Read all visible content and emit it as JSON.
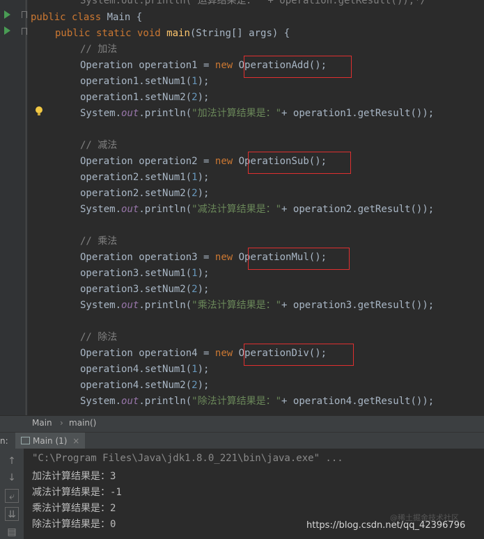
{
  "editor": {
    "top_partial": "System.out.println(\"运算结果是：\" + operation.getResult());*/",
    "class_decl": {
      "kw": "public class ",
      "name": "Main {"
    },
    "main_decl": {
      "kw1": "public static void ",
      "fn": "main",
      "rest": "(String[] args) {"
    },
    "blocks": [
      {
        "comment": "// 加法",
        "cls": "OperationAdd",
        "var": "operation1",
        "msg": "\"加法计算结果是：\""
      },
      {
        "comment": "// 减法",
        "cls": "OperationSub",
        "var": "operation2",
        "msg": "\"减法计算结果是：\""
      },
      {
        "comment": "// 乘法",
        "cls": "OperationMul",
        "var": "operation3",
        "msg": "\"乘法计算结果是：\""
      },
      {
        "comment": "// 除法",
        "cls": "OperationDiv",
        "var": "operation4",
        "msg": "\"除法计算结果是：\""
      }
    ],
    "tokens": {
      "type": "Operation ",
      "assign": " = ",
      "new": "new ",
      "call_end": "();",
      "set1": ".setNum1(",
      "set2": ".setNum2(",
      "n1": "1",
      "n2": "2",
      "close": ");",
      "sys": "System.",
      "out": "out",
      "println": ".println(",
      "plus": "+ ",
      "get": ".getResult());"
    }
  },
  "breadcrumb": {
    "class": "Main",
    "sep": "›",
    "method": "main()"
  },
  "run_panel": {
    "label_prefix": "n:",
    "tab_label": "Main (1)",
    "tab_close": "×"
  },
  "console": {
    "lines": [
      "\"C:\\Program Files\\Java\\jdk1.8.0_221\\bin\\java.exe\" ...",
      "加法计算结果是：3",
      "减法计算结果是：-1",
      "乘法计算结果是：2",
      "除法计算结果是：0"
    ]
  },
  "watermarks": {
    "csdn": "https://blog.csdn.net/qq_42396796",
    "juejin": "@稀土掘金技术社区"
  },
  "colors": {
    "keyword": "#cc7832",
    "method": "#ffc66d",
    "number": "#6897bb",
    "string": "#6a8759",
    "comment": "#808080",
    "static_field": "#9876aa",
    "highlight_box": "#e03030",
    "run_icon": "#499c54"
  }
}
